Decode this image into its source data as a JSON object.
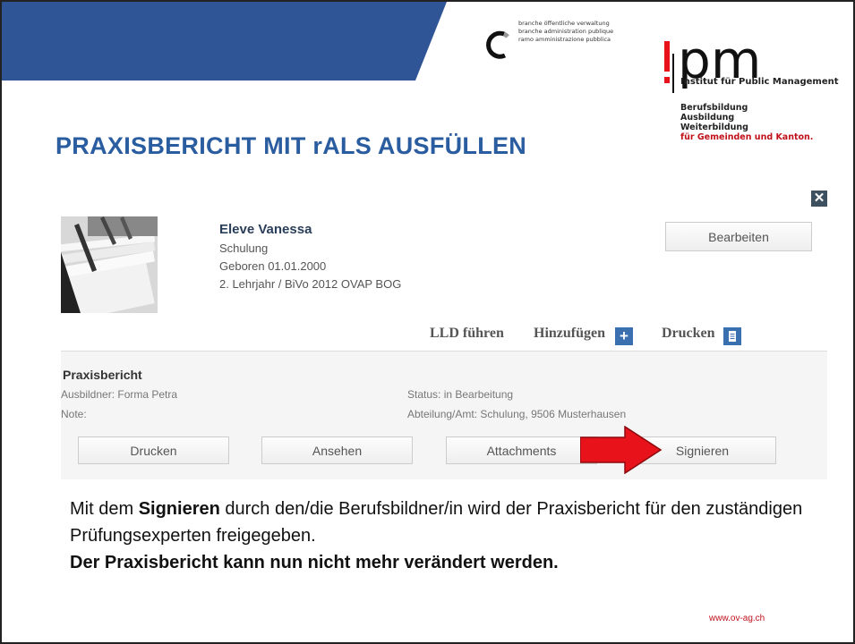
{
  "slide": {
    "title": "PRAXISBERICHT MIT rALS AUSFÜLLEN",
    "footer_url": "www.ov-ag.ch"
  },
  "branding": {
    "branche_lines": [
      "branche öffentliche verwaltung",
      "branche administration publique",
      "ramo amministrazione pubblica"
    ],
    "ipm_logo": "pm",
    "ipm_name": "Institut für Public Management",
    "ipm_lines": [
      "Berufsbildung",
      "Ausbildung",
      "Weiterbildung"
    ],
    "ipm_tagline": "für Gemeinden und Kanton."
  },
  "profile": {
    "name": "Eleve Vanessa",
    "department": "Schulung",
    "birth": "Geboren 01.01.2000",
    "program": "2. Lehrjahr / BiVo 2012 OVAP BOG",
    "edit_button": "Bearbeiten"
  },
  "toolbar": {
    "lld": "LLD führen",
    "add": "Hinzufügen",
    "print": "Drucken"
  },
  "report": {
    "title": "Praxisbericht",
    "trainer": "Ausbildner: Forma Petra",
    "note": "Note:",
    "status": "Status: in Bearbeitung",
    "department": "Abteilung/Amt: Schulung, 9506 Musterhausen",
    "buttons": {
      "print": "Drucken",
      "view": "Ansehen",
      "attachments": "Attachments",
      "sign": "Signieren"
    }
  },
  "explanation": {
    "part1": "Mit dem ",
    "bold1": "Signieren",
    "part2": " durch den/die Berufsbildner/in wird der Praxisbericht für den zuständigen Prüfungsexperten freigegeben.",
    "bold2": "Der Praxisbericht kann nun nicht mehr verändert werden."
  },
  "colors": {
    "banner": "#2f5597",
    "title": "#2a5ca0",
    "accent_red": "#e8121b",
    "brand_red": "#c0111a"
  }
}
